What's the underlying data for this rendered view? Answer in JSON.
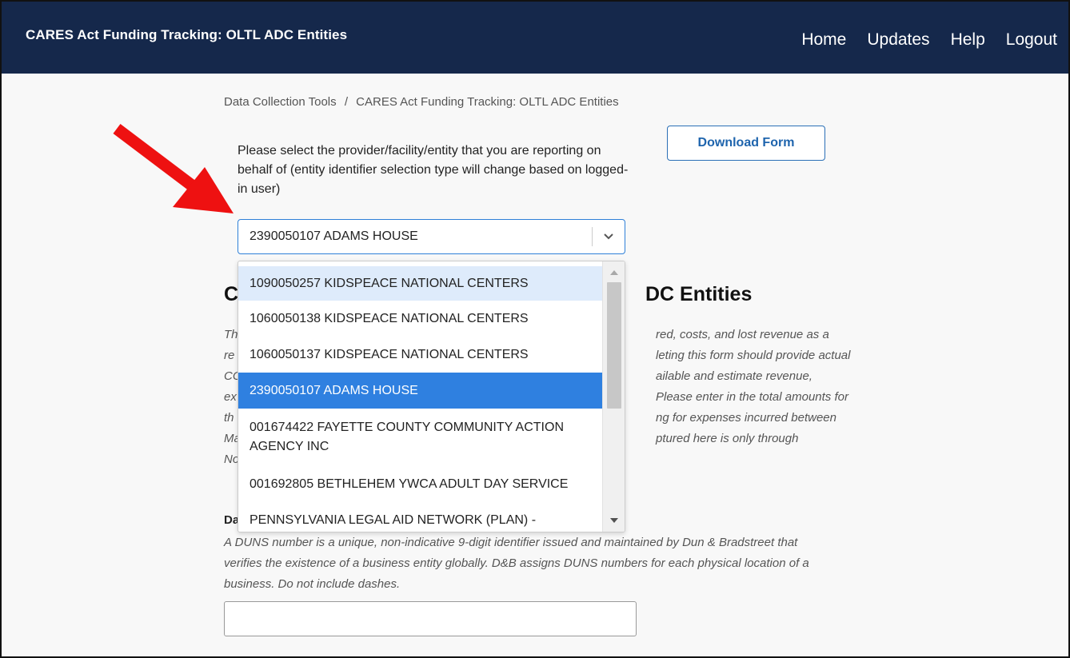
{
  "header": {
    "app_title": "CARES Act Funding Tracking: OLTL ADC Entities",
    "nav": [
      "Home",
      "Updates",
      "Help",
      "Logout"
    ],
    "background": "#15284b"
  },
  "breadcrumb": {
    "items": [
      "Data Collection Tools",
      "CARES Act Funding Tracking: OLTL ADC Entities"
    ],
    "separator": "/"
  },
  "download_button": {
    "label": "Download Form"
  },
  "entity_select": {
    "prompt": "Please select the provider/facility/entity that you are reporting on behalf of (entity identifier selection type will change based on logged-in user)",
    "selected_value": "2390050107 ADAMS HOUSE",
    "options": [
      "1090050257 KIDSPEACE NATIONAL CENTERS",
      "1060050138 KIDSPEACE NATIONAL CENTERS",
      "1060050137 KIDSPEACE NATIONAL CENTERS",
      "2390050107 ADAMS HOUSE",
      "001674422 FAYETTE COUNTY COMMUNITY ACTION AGENCY INC",
      "001692805 BETHLEHEM YWCA ADULT DAY SERVICE",
      "PENNSYLVANIA LEGAL AID NETWORK (PLAN) -"
    ],
    "accent_color": "#2f80e0"
  },
  "section": {
    "title_start": "C",
    "title_end": "DC Entities",
    "desc_left": [
      "Th",
      "re",
      "CC",
      "ex",
      "th",
      "Ma",
      "No"
    ],
    "desc_right": [
      "red, costs, and lost revenue as a",
      "leting this form should provide actual",
      "ailable and estimate revenue,",
      "Please enter in the total amounts for",
      "ng for expenses incurred between",
      "ptured here is only through"
    ]
  },
  "duns": {
    "label_start": "Da",
    "help": "A DUNS number is a unique, non-indicative 9-digit identifier issued and maintained by Dun & Bradstreet that verifies the existence of a business entity globally. D&B assigns DUNS numbers for each physical location of a business. Do not include dashes.",
    "value": ""
  }
}
